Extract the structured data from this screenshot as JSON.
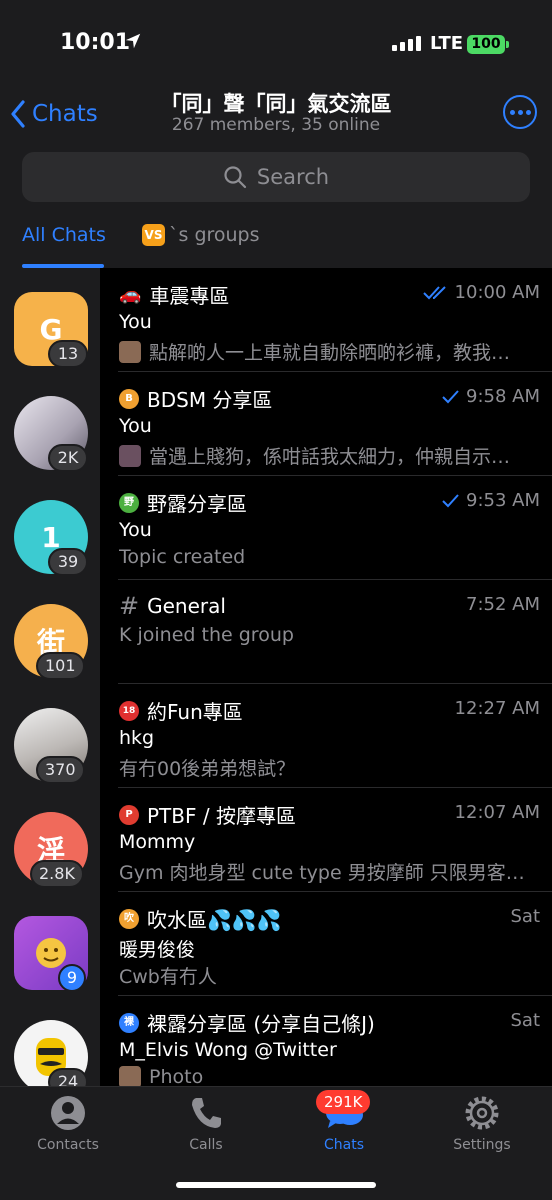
{
  "status": {
    "time": "10:01",
    "network": "LTE",
    "battery": "100"
  },
  "header": {
    "back_label": "Chats",
    "title": "「同」聲「同」氣交流區",
    "subtitle": "267 members, 35 online",
    "search_placeholder": "Search"
  },
  "tabs": [
    {
      "label": "All Chats"
    },
    {
      "badge": "VS",
      "label": "`s groups"
    }
  ],
  "avatars": [
    {
      "initial": "G",
      "count": "13",
      "color": "#f6b24a"
    },
    {
      "initial": "",
      "count": "2K",
      "color": "#c9c6cf"
    },
    {
      "initial": "1",
      "count": "39",
      "color": "#3ccbd1"
    },
    {
      "initial": "街",
      "count": "101",
      "color": "#f5b04d"
    },
    {
      "initial": "",
      "count": "370",
      "color": "#b9b6b4"
    },
    {
      "initial": "淫",
      "count": "2.8K",
      "color": "#f06a5b"
    },
    {
      "initial": "",
      "count": "9",
      "color": "#a04fd6"
    },
    {
      "initial": "",
      "count": "24",
      "color": "#f4f4f4"
    }
  ],
  "topics": [
    {
      "icon": "🚗",
      "name": "車震專區",
      "time": "10:00 AM",
      "ticks": "double",
      "sender": "You",
      "preview": "點解啲人一上車就自動除晒啲衫褲，教我…",
      "thumb": "#8a6a55"
    },
    {
      "icon": "B",
      "icon_color": "#f0a030",
      "name": "BDSM 分享區",
      "time": "9:58 AM",
      "ticks": "single",
      "sender": "You",
      "preview": "當遇上賤狗，係咁話我太細力，仲親自示…",
      "thumb": "#6a5060"
    },
    {
      "icon": "野",
      "icon_color": "#4cb040",
      "name": "野露分享區",
      "time": "9:53 AM",
      "ticks": "single",
      "sender": "You",
      "preview": "Topic created"
    },
    {
      "icon": "#",
      "name": "General",
      "time": "7:52 AM",
      "preview": "K joined the group"
    },
    {
      "icon": "18",
      "icon_color": "#e03030",
      "name": "約Fun專區",
      "time": "12:27 AM",
      "sender": "hkg",
      "preview": "有冇00後弟弟想試？"
    },
    {
      "icon": "P",
      "icon_color": "#e03c30",
      "name": "PTBF / 按摩專區",
      "time": "12:07 AM",
      "sender": "Mommy",
      "preview": "Gym 肉地身型 cute type 男按摩師 只限男客…"
    },
    {
      "icon": "吹",
      "icon_color": "#f0a030",
      "name": "吹水區💦💦💦",
      "time": "Sat",
      "sender": "暖男俊俊",
      "preview": "Cwb有冇人"
    },
    {
      "icon": "裸",
      "icon_color": "#2f80ff",
      "name": "裸露分享區 (分享自己條J)",
      "time": "Sat",
      "sender": "M_Elvis Wong @Twitter",
      "preview": "Photo",
      "thumb": "#8a6a55"
    }
  ],
  "tabbar": [
    {
      "label": "Contacts"
    },
    {
      "label": "Calls"
    },
    {
      "label": "Chats",
      "badge": "291K"
    },
    {
      "label": "Settings"
    }
  ],
  "colors": {
    "accent": "#2f80ff",
    "background": "#000000",
    "panel": "#1c1c1e",
    "secondary_text": "#8e8e93"
  }
}
